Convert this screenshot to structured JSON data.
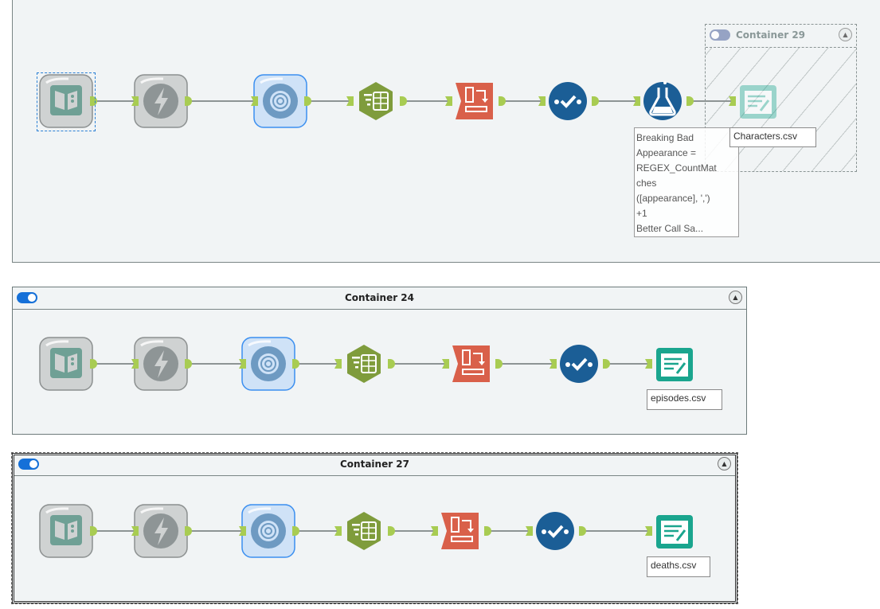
{
  "containers": {
    "top": {
      "tools": [
        "input",
        "dynamic-input",
        "cleanse",
        "select",
        "transpose",
        "check",
        "formula",
        "output-faded"
      ],
      "annotation": "Breaking Bad\nAppearance =\nREGEX_CountMat\nches\n([appearance], ',')\n+1\nBetter Call Sa...",
      "nested": {
        "title": "Container 29",
        "enabled": false,
        "output_label": "Characters.csv"
      }
    },
    "c24": {
      "title": "Container 24",
      "enabled": true,
      "tools": [
        "input",
        "dynamic-input",
        "cleanse",
        "select",
        "transpose",
        "check",
        "output"
      ],
      "output_label": "episodes.csv"
    },
    "c27": {
      "title": "Container 27",
      "enabled": true,
      "selected": true,
      "tools": [
        "input",
        "dynamic-input",
        "cleanse",
        "select",
        "transpose",
        "check",
        "output"
      ],
      "output_label": "deaths.csv"
    }
  },
  "colors": {
    "canvas": "#f1f4f5",
    "anchor": "#a8cc52",
    "toggle_on": "#1570d8",
    "select_tool": "#7f9c3c",
    "transpose_tool": "#d9604a",
    "check_tool": "#1b5e96",
    "output_tool": "#1aa58e"
  }
}
